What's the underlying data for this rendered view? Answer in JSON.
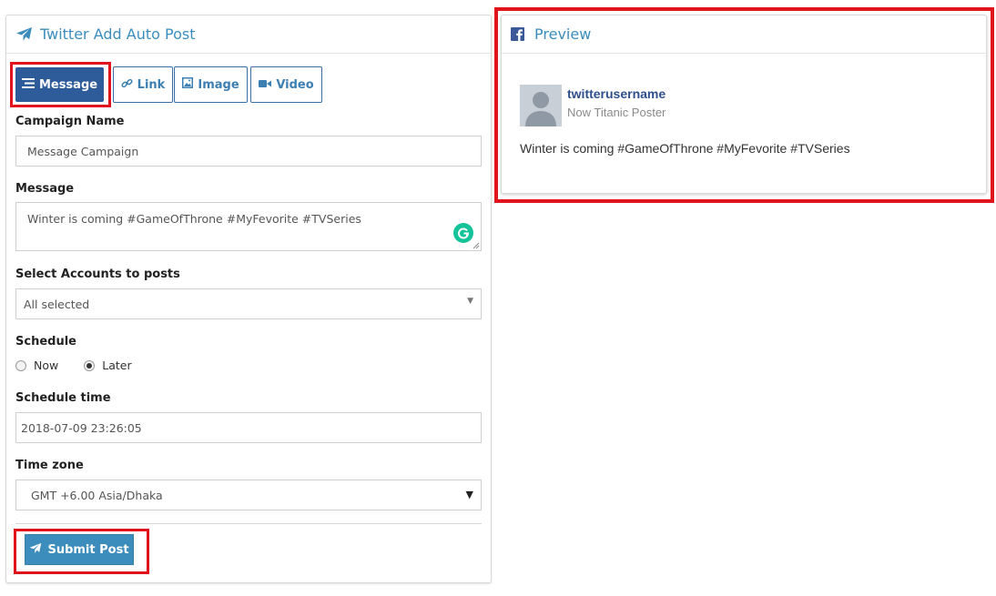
{
  "left_panel": {
    "title": "Twitter Add Auto Post",
    "tabs": [
      {
        "label": "Message",
        "icon": "list-icon",
        "active": true
      },
      {
        "label": "Link",
        "icon": "link-icon",
        "active": false
      },
      {
        "label": "Image",
        "icon": "image-icon",
        "active": false
      },
      {
        "label": "Video",
        "icon": "video-icon",
        "active": false
      }
    ],
    "campaign_name": {
      "label": "Campaign Name",
      "value": "Message Campaign"
    },
    "message": {
      "label": "Message",
      "value": "Winter is coming #GameOfThrone #MyFevorite #TVSeries"
    },
    "accounts": {
      "label": "Select Accounts to posts",
      "value": "All selected"
    },
    "schedule": {
      "label": "Schedule",
      "options": [
        "Now",
        "Later"
      ],
      "selected": "Later"
    },
    "schedule_time": {
      "label": "Schedule time",
      "value": "2018-07-09 23:26:05"
    },
    "timezone": {
      "label": "Time zone",
      "value": "GMT +6.00 Asia/Dhaka"
    },
    "submit_label": "Submit Post"
  },
  "preview": {
    "title": "Preview",
    "username": "twitterusername",
    "subtitle": "Now Titanic Poster",
    "post_text": "Winter is coming #GameOfThrone #MyFevorite #TVSeries"
  },
  "colors": {
    "accent": "#3c8dbc",
    "active_tab": "#2e5b9a",
    "highlight": "#e1141e",
    "facebook": "#3b5998"
  }
}
